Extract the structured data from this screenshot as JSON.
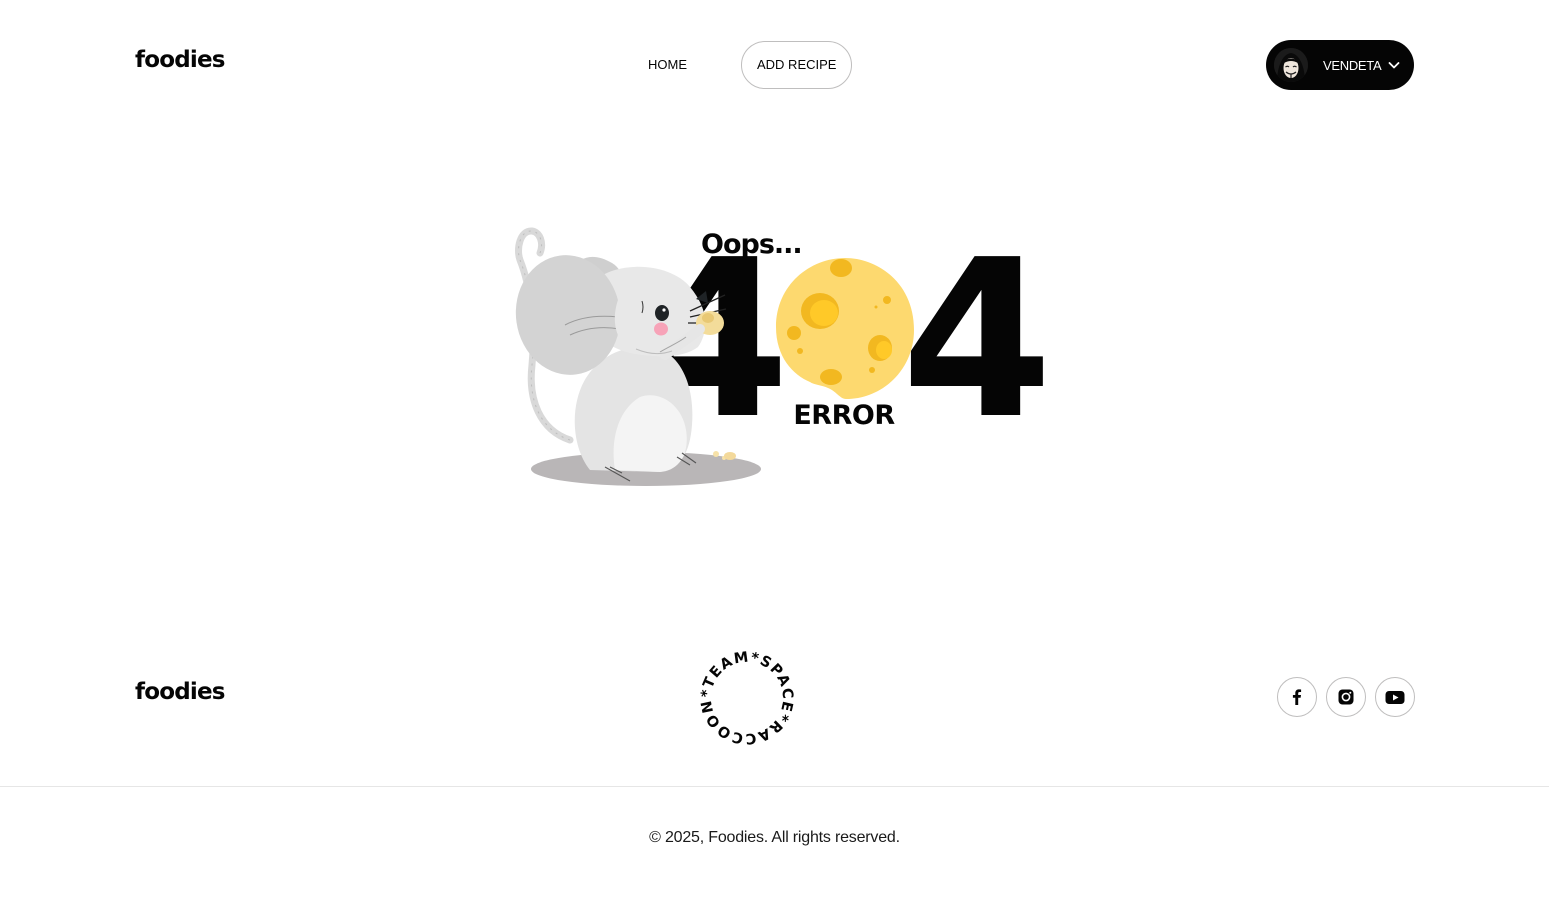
{
  "header": {
    "logo": "foodies",
    "nav": [
      {
        "label": "HOME"
      },
      {
        "label": "ADD RECIPE"
      }
    ],
    "user": {
      "name": "VENDETA"
    }
  },
  "error": {
    "oops": "Oops...",
    "code_left": "4",
    "code_right": "4",
    "subtitle": "ERROR"
  },
  "footer": {
    "logo": "foodies",
    "badge_text": "*TEAM*SPACE*RACCOONS",
    "socials": [
      {
        "icon": "facebook-icon"
      },
      {
        "icon": "instagram-icon"
      },
      {
        "icon": "youtube-icon"
      }
    ],
    "copyright": "© 2025, Foodies. All rights reserved."
  },
  "colors": {
    "ink": "#050505",
    "border": "#bfbebe",
    "cheese": "#fdd96f",
    "cheese_hole": "#f2b820",
    "mouse": "#e6e6e6"
  }
}
